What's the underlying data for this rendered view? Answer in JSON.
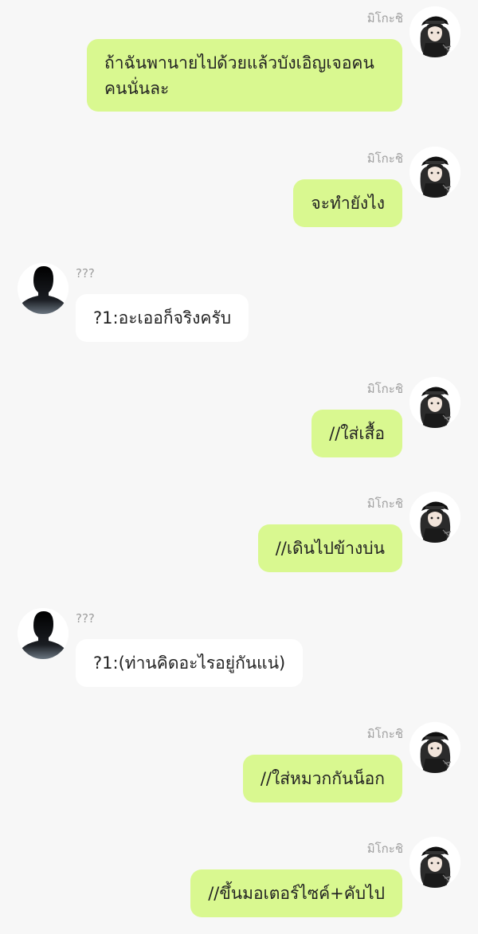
{
  "colors": {
    "background": "#f7f7f7",
    "self_bubble": "#d9f890",
    "other_bubble": "#ffffff",
    "name_text": "#9e9e9e"
  },
  "messages": [
    {
      "sender": "มิโกะชิ",
      "avatar_icon": "anime-girl-avatar-icon",
      "text": "ถ้าฉันพานายไปด้วยแล้วบังเอิญเจอคนคนนั่นละ"
    },
    {
      "sender": "มิโกะชิ",
      "avatar_icon": "anime-girl-avatar-icon",
      "text": "จะทำยังไง"
    },
    {
      "sender": "???",
      "avatar_icon": "silhouette-avatar-icon",
      "text": "?1:อะเออก็จริงครับ"
    },
    {
      "sender": "มิโกะชิ",
      "avatar_icon": "anime-girl-avatar-icon",
      "text": "//ใส่เสื้อ"
    },
    {
      "sender": "มิโกะชิ",
      "avatar_icon": "anime-girl-avatar-icon",
      "text": "//เดินไปข้างบ่น"
    },
    {
      "sender": "???",
      "avatar_icon": "silhouette-avatar-icon",
      "text": "?1:(ท่านคิดอะไรอยู่กันแน่)"
    },
    {
      "sender": "มิโกะชิ",
      "avatar_icon": "anime-girl-avatar-icon",
      "text": "//ใส่หมวกกันน็อก"
    },
    {
      "sender": "มิโกะชิ",
      "avatar_icon": "anime-girl-avatar-icon",
      "text": "//ขึ้นมอเตอร์ไซค์+คับไป"
    }
  ]
}
